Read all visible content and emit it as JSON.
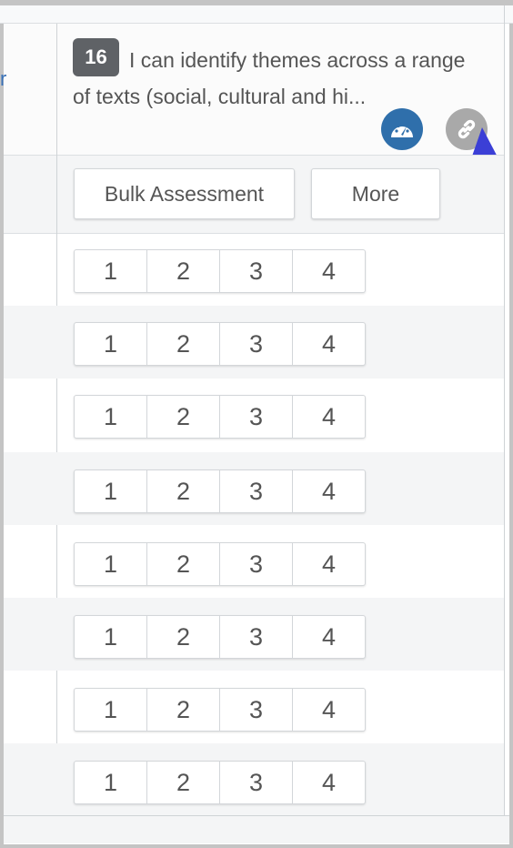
{
  "left_column": {
    "cut_header_letter": "r"
  },
  "outcome": {
    "number": "16",
    "text": "I can identify themes across a range of texts (social, cultural and hi..."
  },
  "icons": {
    "gauge": "dashboard-gauge-icon",
    "link": "link-chain-icon",
    "arrow": "pointer-arrow-annotation"
  },
  "colors": {
    "badge": "#5f6266",
    "gauge": "#2f6fab",
    "link": "#a9a9a9",
    "arrow": "#3b3fd6"
  },
  "actions": {
    "bulk_label": "Bulk Assessment",
    "more_label": "More"
  },
  "score_options": [
    "1",
    "2",
    "3",
    "4"
  ],
  "rows": [
    {
      "scores": [
        "1",
        "2",
        "3",
        "4"
      ]
    },
    {
      "scores": [
        "1",
        "2",
        "3",
        "4"
      ]
    },
    {
      "scores": [
        "1",
        "2",
        "3",
        "4"
      ]
    },
    {
      "scores": [
        "1",
        "2",
        "3",
        "4"
      ]
    },
    {
      "scores": [
        "1",
        "2",
        "3",
        "4"
      ]
    },
    {
      "scores": [
        "1",
        "2",
        "3",
        "4"
      ]
    },
    {
      "scores": [
        "1",
        "2",
        "3",
        "4"
      ]
    },
    {
      "scores": [
        "1",
        "2",
        "3",
        "4"
      ]
    }
  ]
}
